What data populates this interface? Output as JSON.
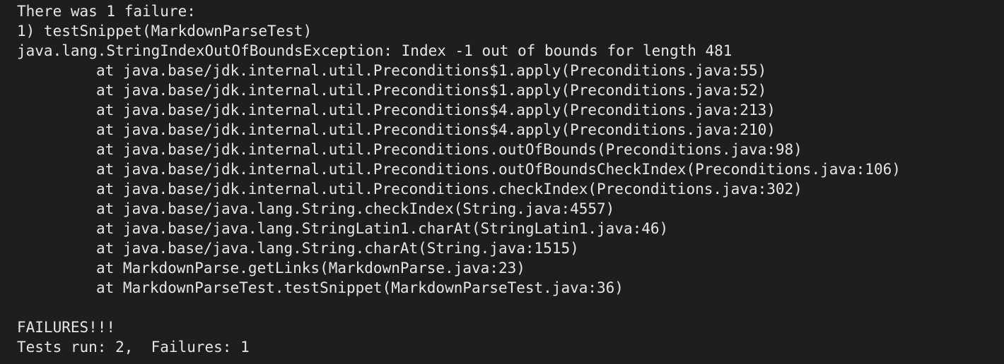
{
  "colors": {
    "background": "#1e1e1e",
    "text": "#e6e6e6"
  },
  "output": {
    "header": "There was 1 failure:",
    "failure_title": "1) testSnippet(MarkdownParseTest)",
    "exception": "java.lang.StringIndexOutOfBoundsException: Index -1 out of bounds for length 481",
    "stack": [
      "at java.base/jdk.internal.util.Preconditions$1.apply(Preconditions.java:55)",
      "at java.base/jdk.internal.util.Preconditions$1.apply(Preconditions.java:52)",
      "at java.base/jdk.internal.util.Preconditions$4.apply(Preconditions.java:213)",
      "at java.base/jdk.internal.util.Preconditions$4.apply(Preconditions.java:210)",
      "at java.base/jdk.internal.util.Preconditions.outOfBounds(Preconditions.java:98)",
      "at java.base/jdk.internal.util.Preconditions.outOfBoundsCheckIndex(Preconditions.java:106)",
      "at java.base/jdk.internal.util.Preconditions.checkIndex(Preconditions.java:302)",
      "at java.base/java.lang.String.checkIndex(String.java:4557)",
      "at java.base/java.lang.StringLatin1.charAt(StringLatin1.java:46)",
      "at java.base/java.lang.String.charAt(String.java:1515)",
      "at MarkdownParse.getLinks(MarkdownParse.java:23)",
      "at MarkdownParseTest.testSnippet(MarkdownParseTest.java:36)"
    ],
    "failures_banner": "FAILURES!!!",
    "summary": "Tests run: 2,  Failures: 1"
  }
}
